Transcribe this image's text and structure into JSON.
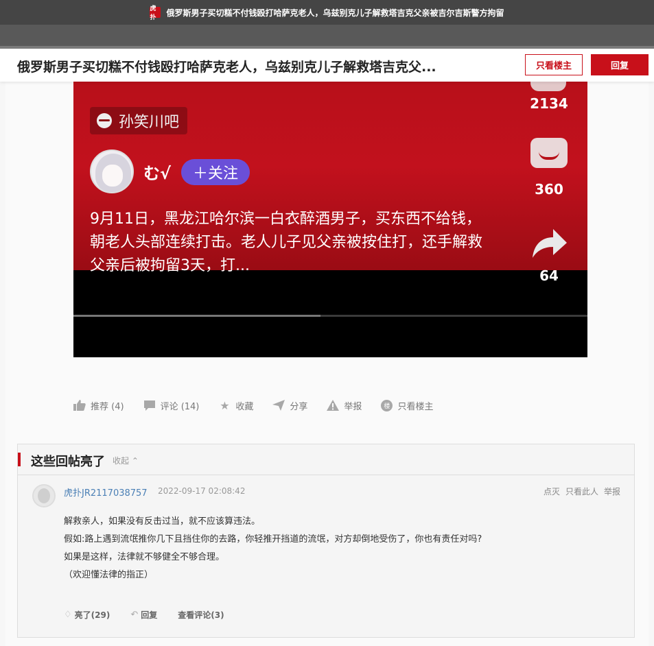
{
  "window": {
    "favicon_text": "虎扑",
    "title": "俄罗斯男子买切糕不付钱殴打哈萨克老人，乌兹别克儿子解救塔吉克父亲被吉尔吉斯警方拘留"
  },
  "header": {
    "thread_title": "俄罗斯男子买切糕不付钱殴打哈萨克老人，乌兹别克儿子解救塔吉克父...",
    "only_op_label": "只看楼主",
    "reply_label": "回复"
  },
  "video": {
    "forum_tag": "孙笑川吧",
    "poster_name": "む√",
    "follow_label": "＋关注",
    "caption": "9月11日，黑龙江哈尔滨一白衣醉酒男子，买东西不给钱，朝老人头部连续打击。老人儿子见父亲被按住打，还手解救父亲后被拘留3天，打...",
    "likes": "2134",
    "comments": "360",
    "shares": "64",
    "progress": 0.48
  },
  "actions": {
    "recommend": "推荐 (4)",
    "comment": "评论 (14)",
    "favorite": "收藏",
    "share": "分享",
    "report": "举报",
    "only_op": "只看楼主",
    "only_op_icon_text": "楼"
  },
  "highlights": {
    "title": "这些回帖亮了",
    "collapse_label": "收起",
    "reply": {
      "user": "虎扑JR2117038757",
      "time": "2022-09-17 02:08:42",
      "ops": [
        "点灭",
        "只看此人",
        "举报"
      ],
      "lines": [
        "解救亲人，如果没有反击过当，就不应该算违法。",
        "假如:路上遇到流氓推你几下且挡住你的去路，你轻推开挡道的流氓，对方却倒地受伤了，你也有责任对吗?",
        "如果是这样，法律就不够健全不够合理。",
        "（欢迎懂法律的指正）"
      ],
      "light_label": "亮了(29)",
      "reply_label": "回复",
      "view_comments_label": "查看评论(3)"
    }
  },
  "colors": {
    "brand_red": "#c8101a",
    "link_blue": "#4a7fb5",
    "follow_purple": "#6a4fd8"
  }
}
